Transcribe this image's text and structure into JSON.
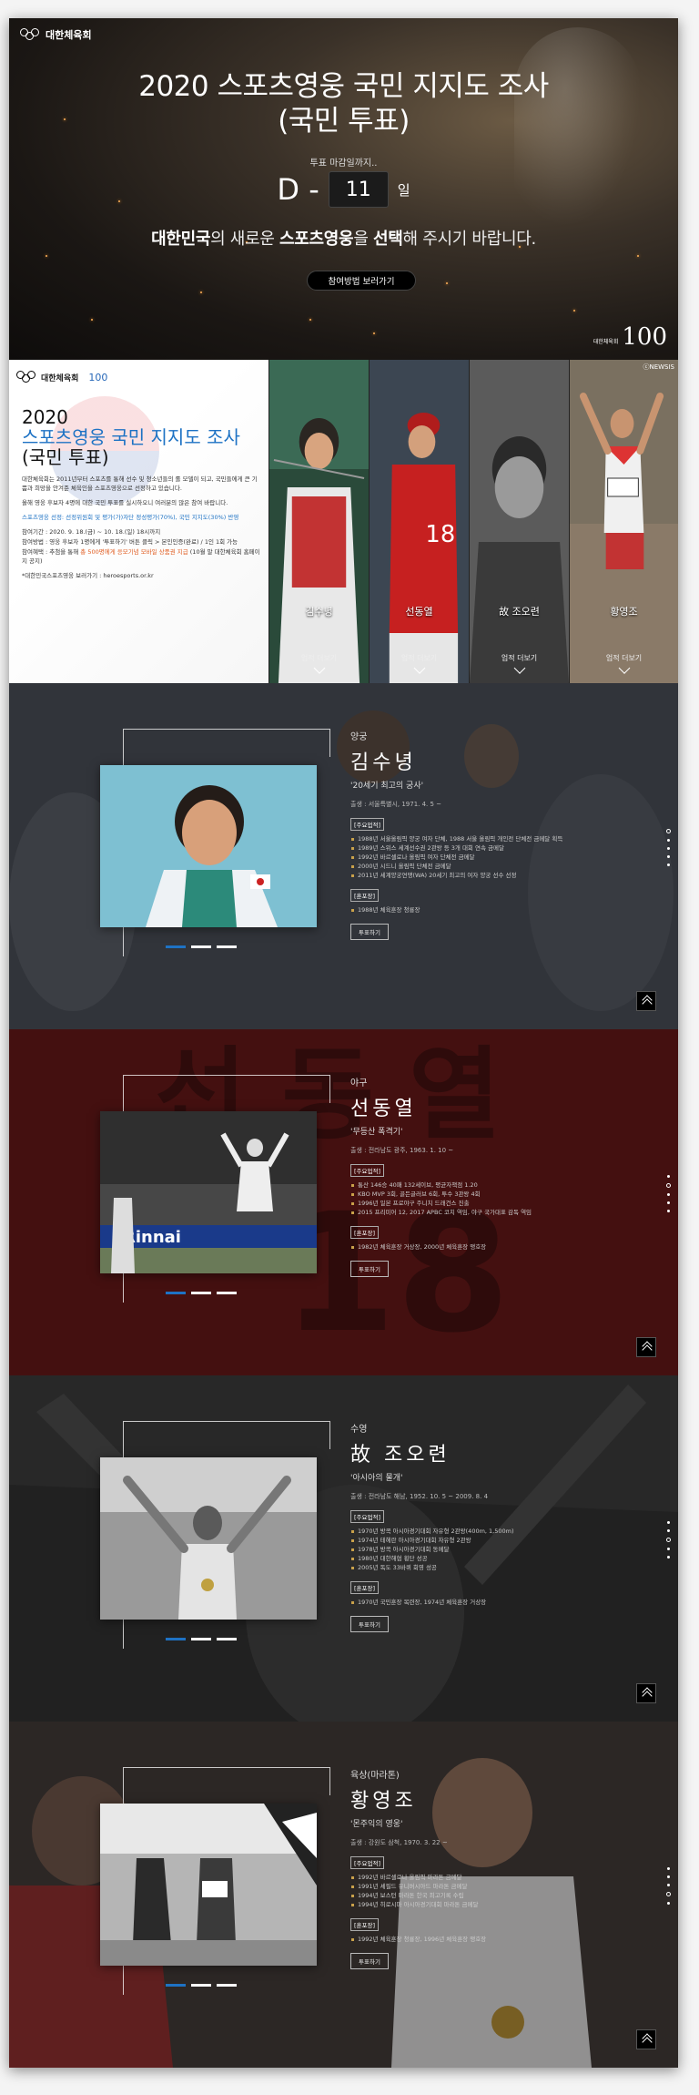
{
  "brand": {
    "name": "대한체육회"
  },
  "hero": {
    "title_line1": "2020 스포츠영웅 국민 지지도 조사",
    "title_line2": "(국민 투표)",
    "deadline_label": "투표 마감일까지..",
    "d_label": "D -",
    "d_value": "11",
    "d_unit": "일",
    "slogan_parts": [
      "대한민국",
      "의 새로운 ",
      "스포츠영웅",
      "을 ",
      "선택",
      "해 주시기 바랍니다."
    ],
    "howto_button": "참여방법 보러가기",
    "emblem": "100"
  },
  "info": {
    "logo_sub": "100",
    "title_year": "2020",
    "title_line1": "스포츠영웅 국민 지지도 조사",
    "title_line2": "(국민 투표)",
    "intro": "대한체육회는 2011년부터 스포츠를 통해 선수 및 청소년들의 롤 모델이 되고, 국민들에게 큰 기쁨과 희망을 안겨준 체육인을 스포츠영웅으로 선정하고 있습니다.",
    "notice": "올해 영웅 후보자 4명에 대한 국민 투표를 실시하오니 여러분의 많은 참여 바랍니다.",
    "method": "스포츠영웅 선정: 선정위원회 및 평가(가)자단 정성평가(70%), 국민 지지도(30%) 반영",
    "period": "참여기간 : 2020. 9. 18.(금) ~ 10. 18.(일) 18시까지",
    "how": "참여방법 : 영웅 후보자 1명에게 '투표하기' 버튼 클릭 > 본인인증(완료) / 1인 1회 가능",
    "gift_prefix": "참여혜택 : 추첨을 통해 ",
    "gift_emph": "총 500명에게 응모기념 모바일 상품권 지급",
    "gift_suffix": " (10월 말 대한체육회 홈페이지 공지)",
    "site": "*대한민국스포츠영웅 보러가기 : heroesports.or.kr"
  },
  "candidates": [
    {
      "name": "김수녕",
      "more": "업적 더보기"
    },
    {
      "name": "선동열",
      "more": "업적 더보기"
    },
    {
      "name": "故 조오련",
      "more": "업적 더보기"
    },
    {
      "name": "황영조",
      "more": "업적 더보기",
      "credit": "ⓒNEWSIS"
    }
  ],
  "athletes": [
    {
      "sport": "양궁",
      "name": "김수녕",
      "nick": "'20세기 최고의 궁사'",
      "born": "출생 : 서울특별시, 1971. 4. 5 ~",
      "main_label": "[주요업적]",
      "main": [
        "1988년 서울올림픽 양궁 여자 단체, 1988 서울 올림픽 개인전 단체전 금메달 획득",
        "1989년 스위스 세계선수권 2관왕 등 3개 대회 연속 금메달",
        "1992년 바르셀로나 올림픽 여자 단체전 금메달",
        "2000년 시드니 올림픽 단체전 금메달",
        "2011년 세계양궁연맹(WA) 20세기 최고의 여자 양궁 선수 선정"
      ],
      "award_label": "[훈포장]",
      "awards": [
        "1988년 체육훈장 청룡장"
      ],
      "more_btn": "투표하기"
    },
    {
      "sport": "야구",
      "name": "선동열",
      "nick": "'무등산 폭격기'",
      "born": "출생 : 전라남도 광주, 1963. 1. 10 ~",
      "main_label": "[주요업적]",
      "main": [
        "통산 146승 40패 132세이브, 평균자책점 1.20",
        "KBO MVP 3회, 골든글러브 6회, 투수 3관왕 4회",
        "1996년 일본 프로야구 주니치 드래건스 진출",
        "2015 프리미어 12, 2017 APBC 코치 역임, 야구 국가대표 감독 역임"
      ],
      "award_label": "[훈포장]",
      "awards": [
        "1982년 체육훈장 거상장, 2000년 체육훈장 맹호장"
      ],
      "more_btn": "투표하기"
    },
    {
      "sport": "수영",
      "name": "故 조오련",
      "nick": "'아시아의 물개'",
      "born": "출생 : 전라남도 해남, 1952. 10. 5 ~ 2009. 8. 4",
      "main_label": "[주요업적]",
      "main": [
        "1970년 방콕 아시아경기대회 자유형 2관왕(400m, 1,500m)",
        "1974년 테헤란 아시아경기대회 자유형 2관왕",
        "1978년 방콕 아시아경기대회 동메달",
        "1980년 대한해협 횡단 성공",
        "2005년 독도 33바퀴 회영 성공"
      ],
      "award_label": "[훈포장]",
      "awards": [
        "1970년 국민훈장 목련장, 1974년 체육훈장 거상장"
      ],
      "more_btn": "투표하기"
    },
    {
      "sport": "육상(마라톤)",
      "name": "황영조",
      "nick": "'몬주익의 영웅'",
      "born": "출생 : 강원도 삼척, 1970. 3. 22 ~",
      "main_label": "[주요업적]",
      "main": [
        "1992년 바르셀로나 올림픽 마라톤 금메달",
        "1991년 셰필드 유니버시아드 마라톤 금메달",
        "1994년 보스턴 마라톤 한국 최고기록 수립",
        "1994년 히로시마 아시아경기대회 마라톤 금메달"
      ],
      "award_label": "[훈포장]",
      "awards": [
        "1992년 체육훈장 청룡장, 1996년 체육훈장 맹호장"
      ],
      "more_btn": "투표하기"
    }
  ],
  "colors": {
    "accent": "#1e72c4",
    "brand_blue": "#1d72c4",
    "highlight": "#e05a1d"
  },
  "icons": {
    "top": "double-chevron-up-icon",
    "more": "chevron-down-icon"
  }
}
